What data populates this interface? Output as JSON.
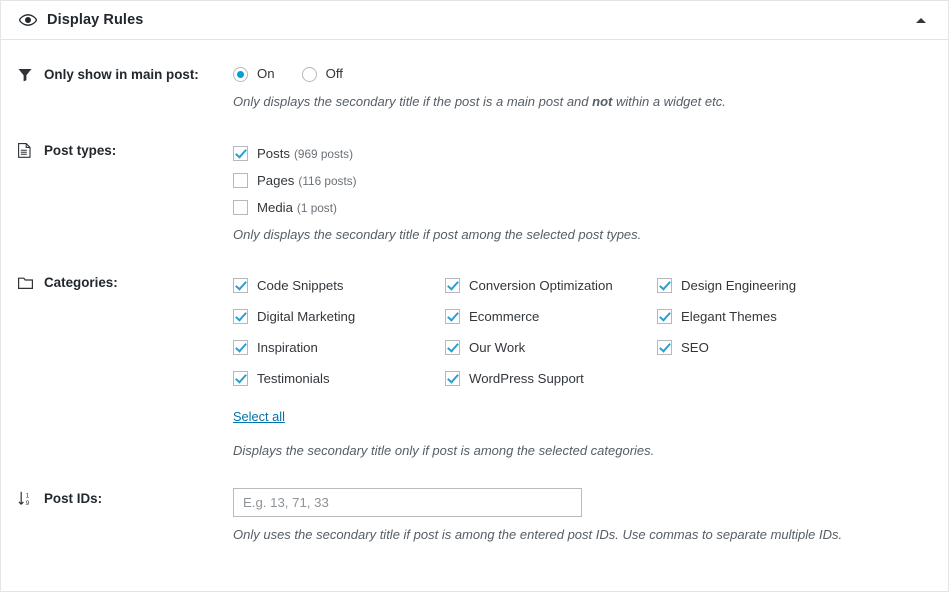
{
  "header": {
    "icon": "eye-icon",
    "title": "Display Rules",
    "collapse_icon": "chevron-up-icon"
  },
  "accent_color": "#00a0d2",
  "check_color": "#2b9fd1",
  "link_color": "#0073aa",
  "sections": {
    "main_post": {
      "icon": "filter-icon",
      "label": "Only show in main post:",
      "options": [
        {
          "label": "On",
          "checked": true
        },
        {
          "label": "Off",
          "checked": false
        }
      ],
      "description_pre": "Only displays the secondary title if the post is a main post and ",
      "description_bold": "not",
      "description_post": " within a widget etc."
    },
    "post_types": {
      "icon": "document-icon",
      "label": "Post types:",
      "items": [
        {
          "label": "Posts",
          "count": "(969 posts)",
          "checked": true
        },
        {
          "label": "Pages",
          "count": "(116 posts)",
          "checked": false
        },
        {
          "label": "Media",
          "count": "(1 post)",
          "checked": false
        }
      ],
      "description": "Only displays the secondary title if post among the selected post types."
    },
    "categories": {
      "icon": "folder-icon",
      "label": "Categories:",
      "items": [
        {
          "label": "Code Snippets",
          "checked": true
        },
        {
          "label": "Conversion Optimization",
          "checked": true
        },
        {
          "label": "Design Engineering",
          "checked": true
        },
        {
          "label": "Digital Marketing",
          "checked": true
        },
        {
          "label": "Ecommerce",
          "checked": true
        },
        {
          "label": "Elegant Themes",
          "checked": true
        },
        {
          "label": "Inspiration",
          "checked": true
        },
        {
          "label": "Our Work",
          "checked": true
        },
        {
          "label": "SEO",
          "checked": true
        },
        {
          "label": "Testimonials",
          "checked": true
        },
        {
          "label": "WordPress Support",
          "checked": true
        }
      ],
      "select_all_label": "Select all",
      "description": "Displays the secondary title only if post is among the selected categories."
    },
    "post_ids": {
      "icon": "sort-numeric-down-icon",
      "label": "Post IDs:",
      "input_value": "",
      "input_placeholder": "E.g. 13, 71, 33",
      "description": "Only uses the secondary title if post is among the entered post IDs. Use commas to separate multiple IDs."
    }
  }
}
